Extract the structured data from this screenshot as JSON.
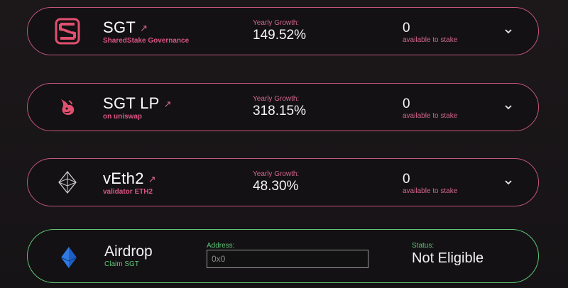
{
  "pools": [
    {
      "name": "SGT",
      "subtitle": "SharedStake Governance",
      "growth_label": "Yearly Growth:",
      "growth_value": "149.52%",
      "stake_value": "0",
      "stake_label": "available to stake",
      "logo_icon": "sharedstake-logo-icon",
      "arrow_icon": "external-arrow-icon",
      "chevron_icon": "chevron-down-icon"
    },
    {
      "name": "SGT LP",
      "subtitle": "on uniswap",
      "growth_label": "Yearly Growth:",
      "growth_value": "318.15%",
      "stake_value": "0",
      "stake_label": "available to stake",
      "logo_icon": "uniswap-unicorn-icon",
      "arrow_icon": "external-arrow-icon",
      "chevron_icon": "chevron-down-icon"
    },
    {
      "name": "vEth2",
      "subtitle": "validator ETH2",
      "growth_label": "Yearly Growth:",
      "growth_value": "48.30%",
      "stake_value": "0",
      "stake_label": "available to stake",
      "logo_icon": "ethereum-diamond-icon",
      "arrow_icon": "external-arrow-icon",
      "chevron_icon": "chevron-down-icon"
    }
  ],
  "airdrop": {
    "title": "Airdrop",
    "subtitle": "Claim SGT",
    "address_label": "Address:",
    "address_placeholder": "0x0",
    "address_value": "",
    "status_label": "Status:",
    "status_value": "Not Eligible",
    "logo_icon": "blue-diamond-icon"
  },
  "colors": {
    "pink_accent": "#c4567c",
    "green_accent": "#5fc478",
    "background": "#1a1719"
  }
}
